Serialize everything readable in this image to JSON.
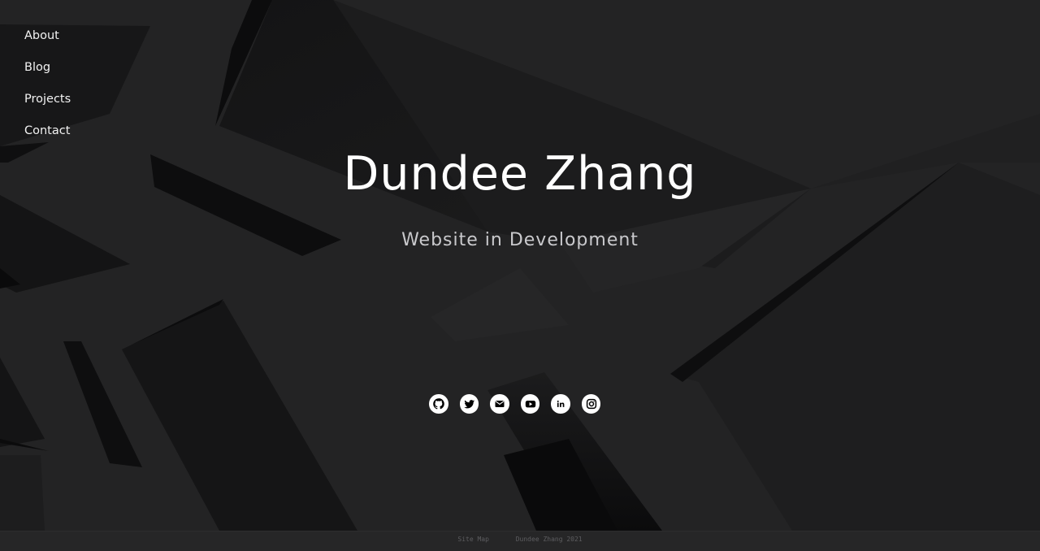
{
  "nav": {
    "items": [
      {
        "label": "About"
      },
      {
        "label": "Blog"
      },
      {
        "label": "Projects"
      },
      {
        "label": "Contact"
      }
    ]
  },
  "hero": {
    "title": "Dundee Zhang",
    "subtitle": "Website in Development"
  },
  "social": {
    "icons": [
      "github-icon",
      "twitter-icon",
      "email-icon",
      "youtube-icon",
      "linkedin-icon",
      "instagram-icon"
    ],
    "icon_color": "#000000",
    "circle_color": "#ffffff"
  },
  "footer": {
    "sitemap_label": "Site Map",
    "copyright": "Dundee Zhang 2021"
  },
  "colors": {
    "background": "#222223",
    "footer_background": "#262627",
    "text": "#ffffff",
    "subtitle_text": "#c9c9cc"
  }
}
